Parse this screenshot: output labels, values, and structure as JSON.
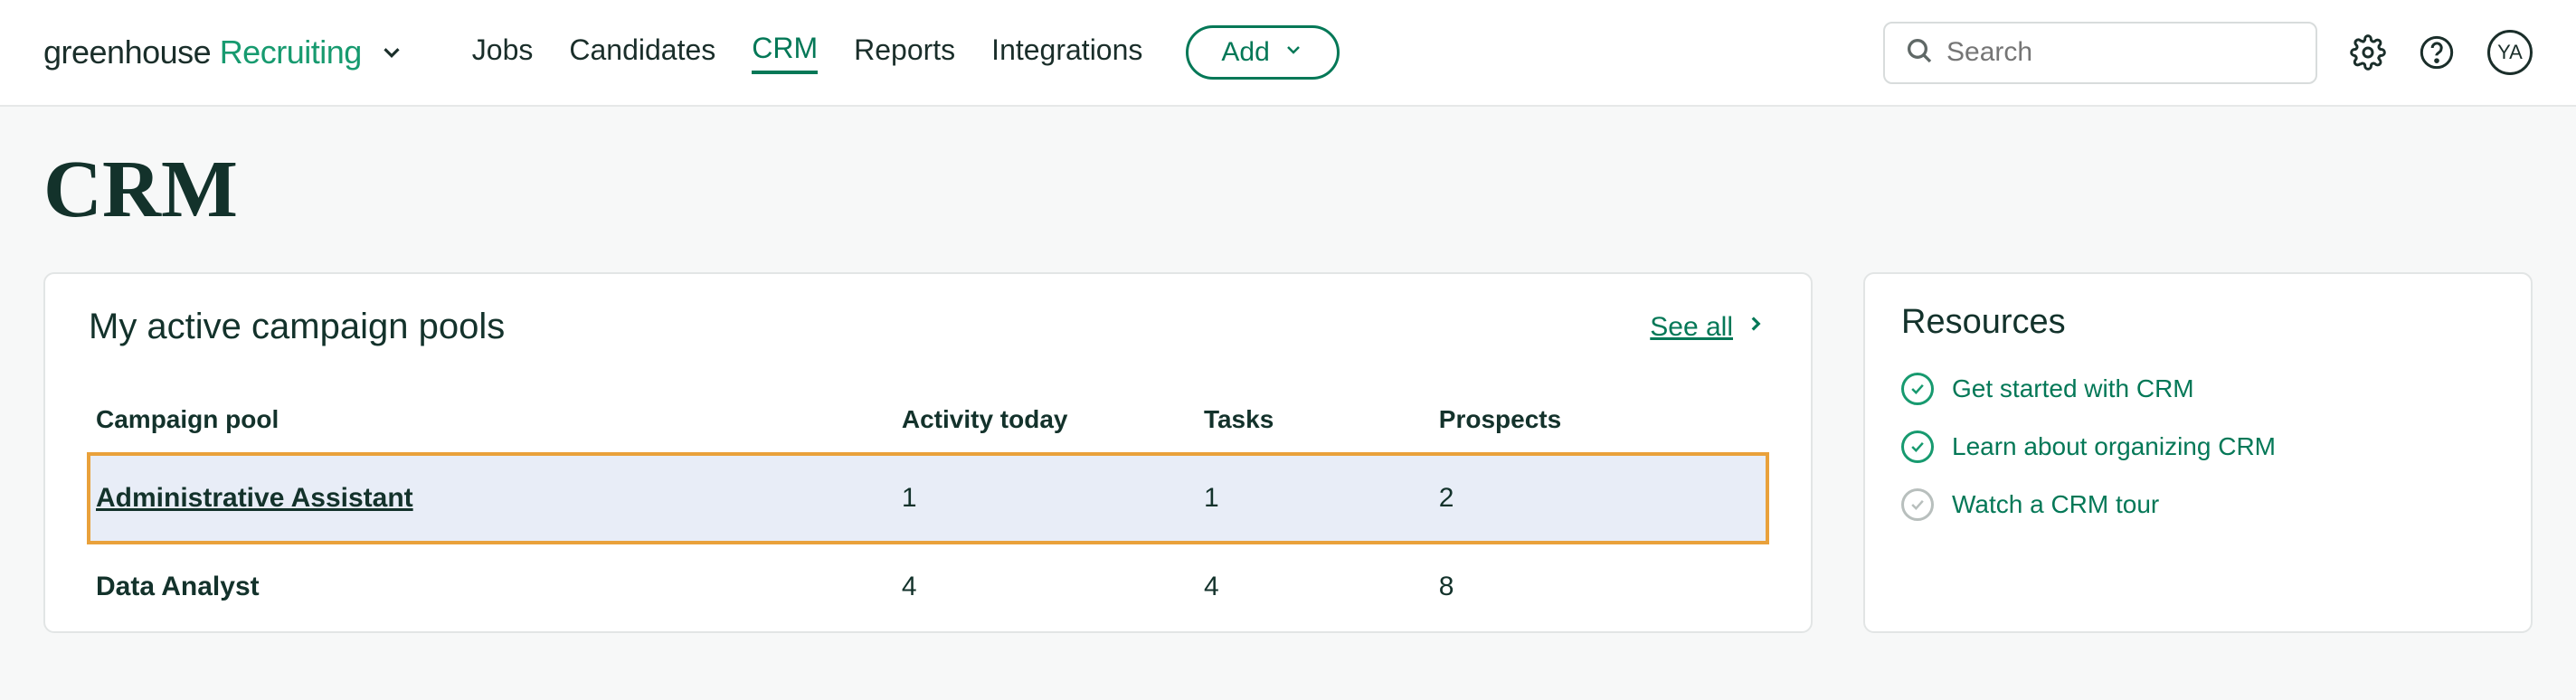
{
  "logo": {
    "word1": "greenhouse",
    "word2": "Recruiting"
  },
  "nav": {
    "items": [
      "Jobs",
      "Candidates",
      "CRM",
      "Reports",
      "Integrations"
    ],
    "active_index": 2
  },
  "add_button": {
    "label": "Add"
  },
  "search": {
    "placeholder": "Search"
  },
  "avatar": {
    "initials": "YA"
  },
  "page": {
    "title": "CRM"
  },
  "pool_panel": {
    "title": "My active campaign pools",
    "see_all": "See all",
    "columns": [
      "Campaign pool",
      "Activity today",
      "Tasks",
      "Prospects"
    ],
    "rows": [
      {
        "name": "Administrative Assistant",
        "activity": "1",
        "tasks": "1",
        "prospects": "2",
        "highlighted": true
      },
      {
        "name": "Data Analyst",
        "activity": "4",
        "tasks": "4",
        "prospects": "8",
        "highlighted": false
      }
    ]
  },
  "resources": {
    "title": "Resources",
    "items": [
      {
        "label": "Get started with CRM",
        "done": true
      },
      {
        "label": "Learn about organizing CRM",
        "done": true
      },
      {
        "label": "Watch a CRM tour",
        "done": false
      }
    ]
  }
}
